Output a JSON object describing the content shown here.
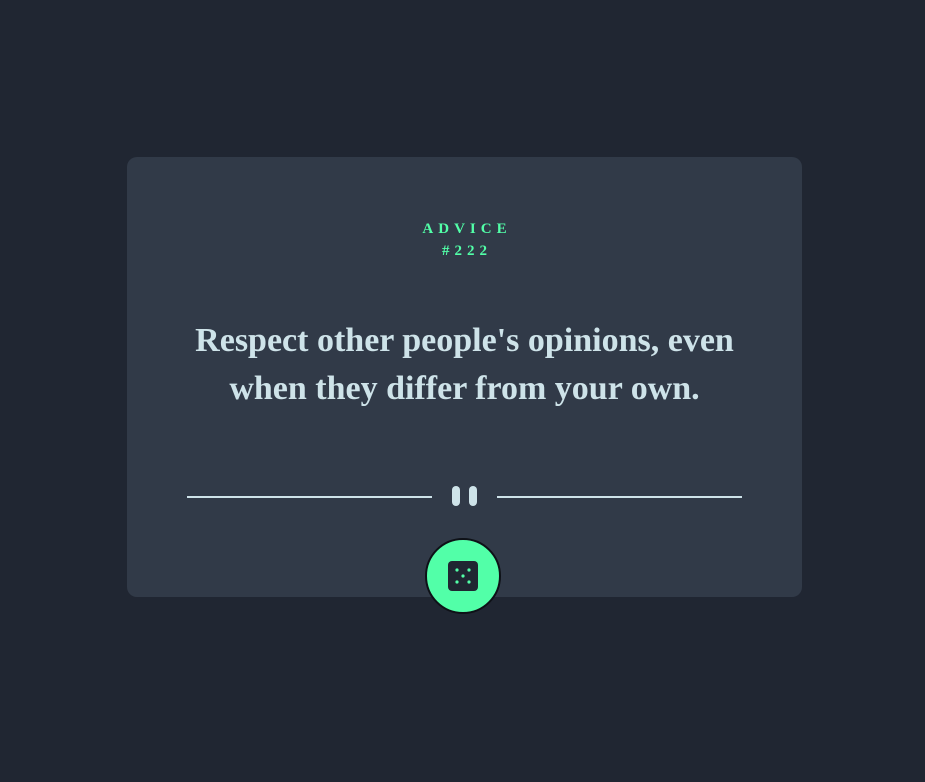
{
  "advice": {
    "label": "ADVICE",
    "number": "#222",
    "text": "Respect other people's opinions, even when they differ from your own."
  },
  "divider": {
    "icon": "pause-icon"
  },
  "button": {
    "icon": "dice-icon"
  },
  "colors": {
    "background": "#202632",
    "card": "#313a48",
    "accent": "#52ffa8",
    "text": "#cee3e9",
    "dice": "#202632"
  }
}
